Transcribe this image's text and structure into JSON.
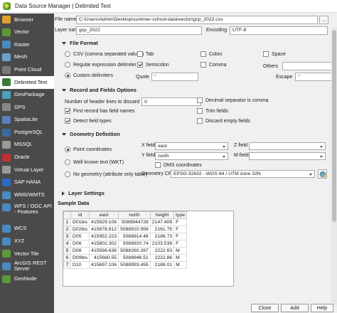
{
  "window": {
    "title": "Data Source Manager | Delimited Text"
  },
  "sidebar": {
    "items": [
      {
        "label": "Browser",
        "icon": "browser-icon",
        "color": "#e0a030"
      },
      {
        "label": "Vector",
        "icon": "vector-icon",
        "color": "#5a9a3a"
      },
      {
        "label": "Raster",
        "icon": "raster-icon",
        "color": "#4a8ac0"
      },
      {
        "label": "Mesh",
        "icon": "mesh-icon",
        "color": "#6aa0d0"
      },
      {
        "label": "Point Cloud",
        "icon": "point-cloud-icon",
        "color": "#7a7a7a"
      },
      {
        "label": "Delimited Text",
        "icon": "delimited-text-icon",
        "color": "#3c7a3c"
      },
      {
        "label": "GeoPackage",
        "icon": "geopackage-icon",
        "color": "#4aa0c0"
      },
      {
        "label": "GPS",
        "icon": "gps-icon",
        "color": "#888888"
      },
      {
        "label": "SpatiaLite",
        "icon": "spatialite-icon",
        "color": "#5a80c0"
      },
      {
        "label": "PostgreSQL",
        "icon": "postgresql-icon",
        "color": "#3a6aa0"
      },
      {
        "label": "MSSQL",
        "icon": "mssql-icon",
        "color": "#9a9a9a"
      },
      {
        "label": "Oracle",
        "icon": "oracle-icon",
        "color": "#c03030"
      },
      {
        "label": "Virtual Layer",
        "icon": "virtual-layer-icon",
        "color": "#9a9a9a"
      },
      {
        "label": "SAP HANA",
        "icon": "sap-hana-icon",
        "color": "#2a6ac0"
      },
      {
        "label": "WMS/WMTS",
        "icon": "wms-icon",
        "color": "#4a8ac0"
      },
      {
        "label": "WFS / OGC API - Features",
        "icon": "wfs-icon",
        "color": "#4a8ac0"
      },
      {
        "label": "WCS",
        "icon": "wcs-icon",
        "color": "#4a8ac0"
      },
      {
        "label": "XYZ",
        "icon": "xyz-icon",
        "color": "#4a8ac0"
      },
      {
        "label": "Vector Tile",
        "icon": "vector-tile-icon",
        "color": "#5a9a3a"
      },
      {
        "label": "ArcGIS REST Server",
        "icon": "arcgis-icon",
        "color": "#4a8ac0"
      },
      {
        "label": "GeoNode",
        "icon": "geonode-icon",
        "color": "#5a9a3a"
      }
    ],
    "active_index": 5
  },
  "file": {
    "label": "File name",
    "value": "C:\\Users\\Admin\\Desktop\\summer-school-data\\vector\\gcp_2022.csv",
    "browse": "…"
  },
  "layer": {
    "label": "Layer name",
    "value": "gcp_2022",
    "encoding_label": "Encoding",
    "encoding_value": "UTF-8"
  },
  "file_format": {
    "header": "File Format",
    "csv": "CSV (comma separated values)",
    "regex": "Regular expression delimiter",
    "custom": "Custom delimiters",
    "tab": "Tab",
    "colon": "Colon",
    "space": "Space",
    "semicolon": "Semicolon",
    "comma": "Comma",
    "others_label": "Others",
    "quote_label": "Quote",
    "quote_value": "\"",
    "escape_label": "Escape",
    "escape_value": "\""
  },
  "record": {
    "header": "Record and Fields Options",
    "header_lines_label": "Number of header lines to discard",
    "header_lines_value": "0",
    "decimal_comma": "Decimal separator is comma",
    "first_record": "First record has field names",
    "trim_fields": "Trim fields",
    "detect_types": "Detect field types",
    "discard_empty": "Discard empty fields"
  },
  "geometry": {
    "header": "Geometry Definition",
    "point": "Point coordinates",
    "wkt": "Well known text (WKT)",
    "none": "No geometry (attribute only table)",
    "x_label": "X field",
    "x_value": "east",
    "y_label": "Y field",
    "y_value": "north",
    "z_label": "Z field",
    "m_label": "M field",
    "dms": "DMS coordinates",
    "crs_label": "Geometry CRS",
    "crs_value": "EPSG:32632 - WGS 84 / UTM zone 32N"
  },
  "layer_settings": {
    "header": "Layer Settings"
  },
  "sample": {
    "header": "Sample Data",
    "columns": [
      "id",
      "east",
      "north",
      "height",
      "type"
    ],
    "rows": [
      [
        "1",
        "D01bis",
        "415929.108",
        "5088944728",
        "2147.409",
        "F"
      ],
      [
        "2",
        "D02bis",
        "415878.812",
        "5088910.958",
        "2161.75",
        "F"
      ],
      [
        "3",
        "D05",
        "415952.223",
        "5088914.48",
        "2186.73",
        "F"
      ],
      [
        "4",
        "D06",
        "415802.302",
        "5088920.74",
        "2103.539",
        "F"
      ],
      [
        "5",
        "D08",
        "415566.638",
        "5088260.267",
        "2222.63",
        "M"
      ],
      [
        "6",
        "D09bis",
        "415660.55",
        "5088948.51",
        "2222.86",
        "M"
      ],
      [
        "7",
        "D10",
        "415697.106",
        "5088993.455",
        "2188.01",
        "M"
      ]
    ]
  },
  "buttons": {
    "close": "Close",
    "add": "Add",
    "help": "Help"
  },
  "colors": {
    "sidebar_bg": "#4a4a4a",
    "accent": "#3c8a2e"
  }
}
